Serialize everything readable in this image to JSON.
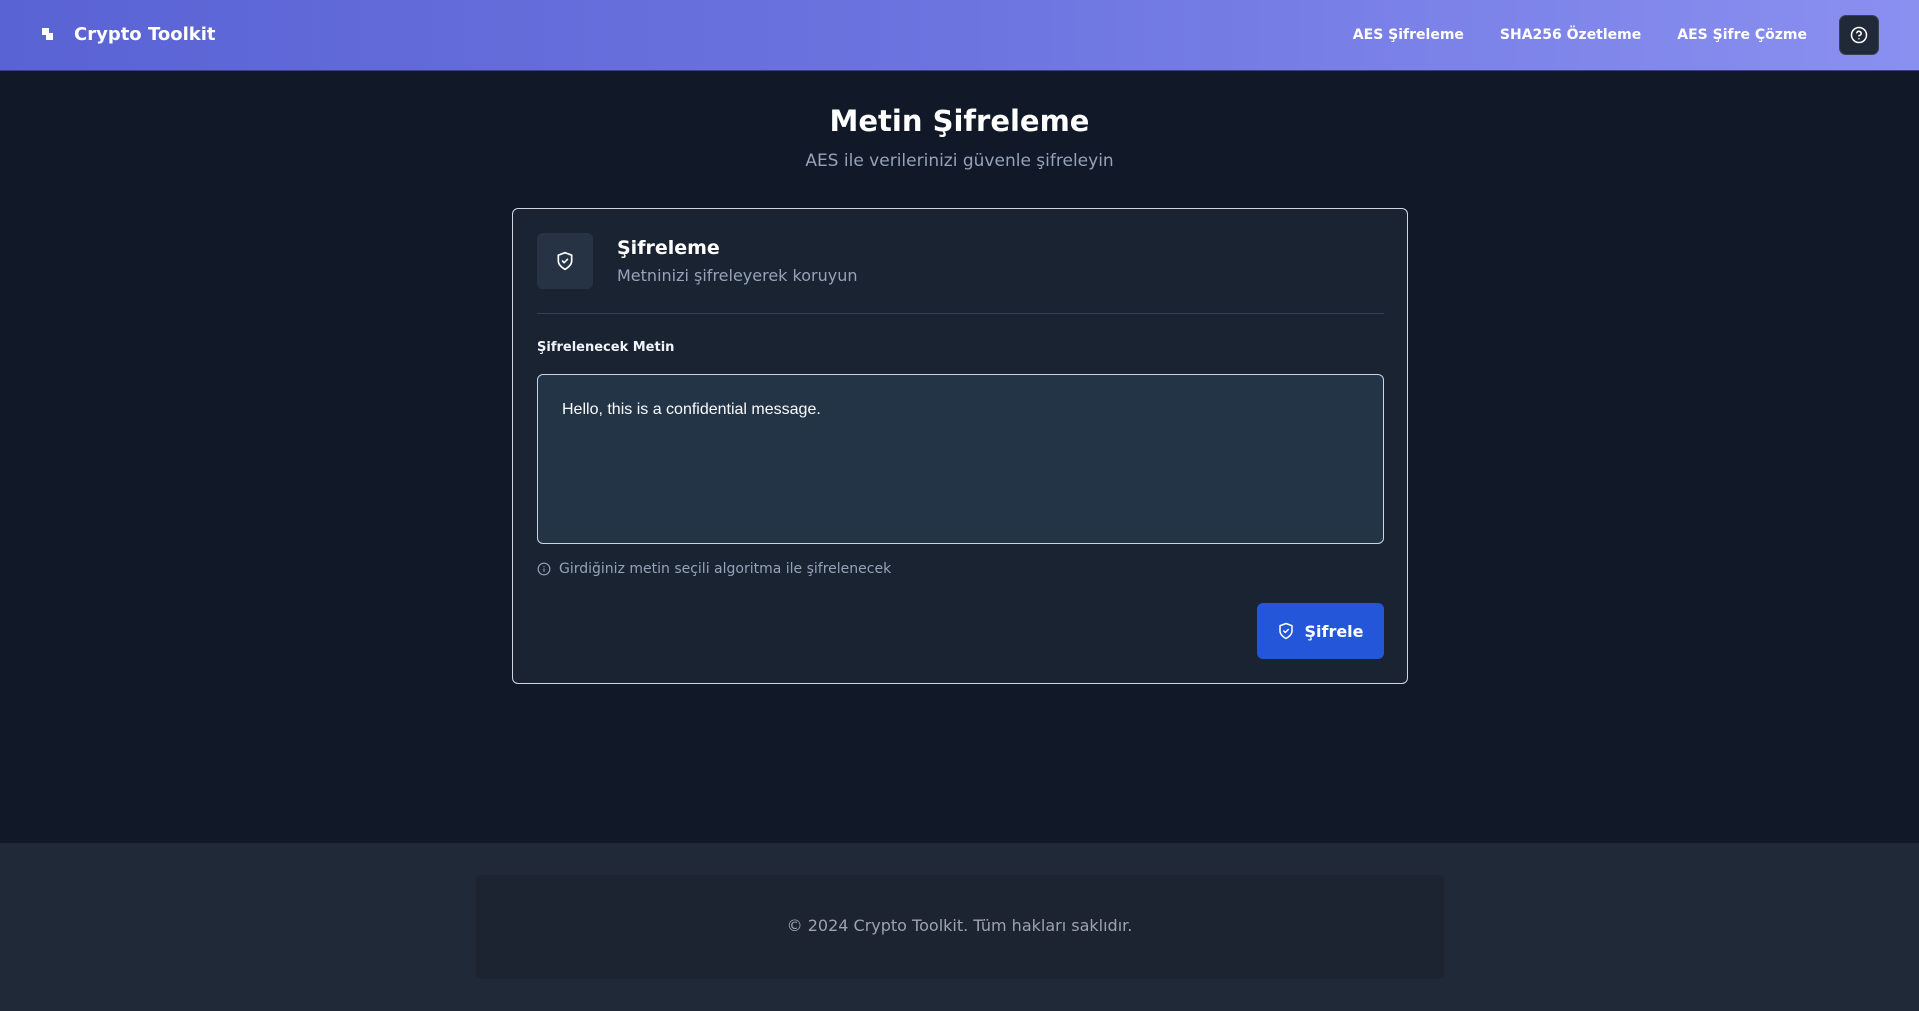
{
  "nav": {
    "brand": "Crypto Toolkit",
    "links": [
      "AES Şifreleme",
      "SHA256 Özetleme",
      "AES Şifre Çözme"
    ]
  },
  "header": {
    "title": "Metin Şifreleme",
    "subtitle": "AES ile verilerinizi güvenle şifreleyin"
  },
  "card": {
    "title": "Şifreleme",
    "description": "Metninizi şifreleyerek koruyun",
    "field_label": "Şifrelenecek Metin",
    "input_value": "Hello, this is a confidential message.",
    "hint": "Girdiğiniz metin seçili algoritma ile şifrelenecek",
    "submit_label": "Şifrele"
  },
  "footer": {
    "copyright": "© 2024 Crypto Toolkit. Tüm hakları saklıdır."
  },
  "colors": {
    "accent": "#2456d9",
    "nav_gradient_start": "#5a63d4",
    "nav_gradient_end": "#8a90f0",
    "background": "#111827"
  }
}
